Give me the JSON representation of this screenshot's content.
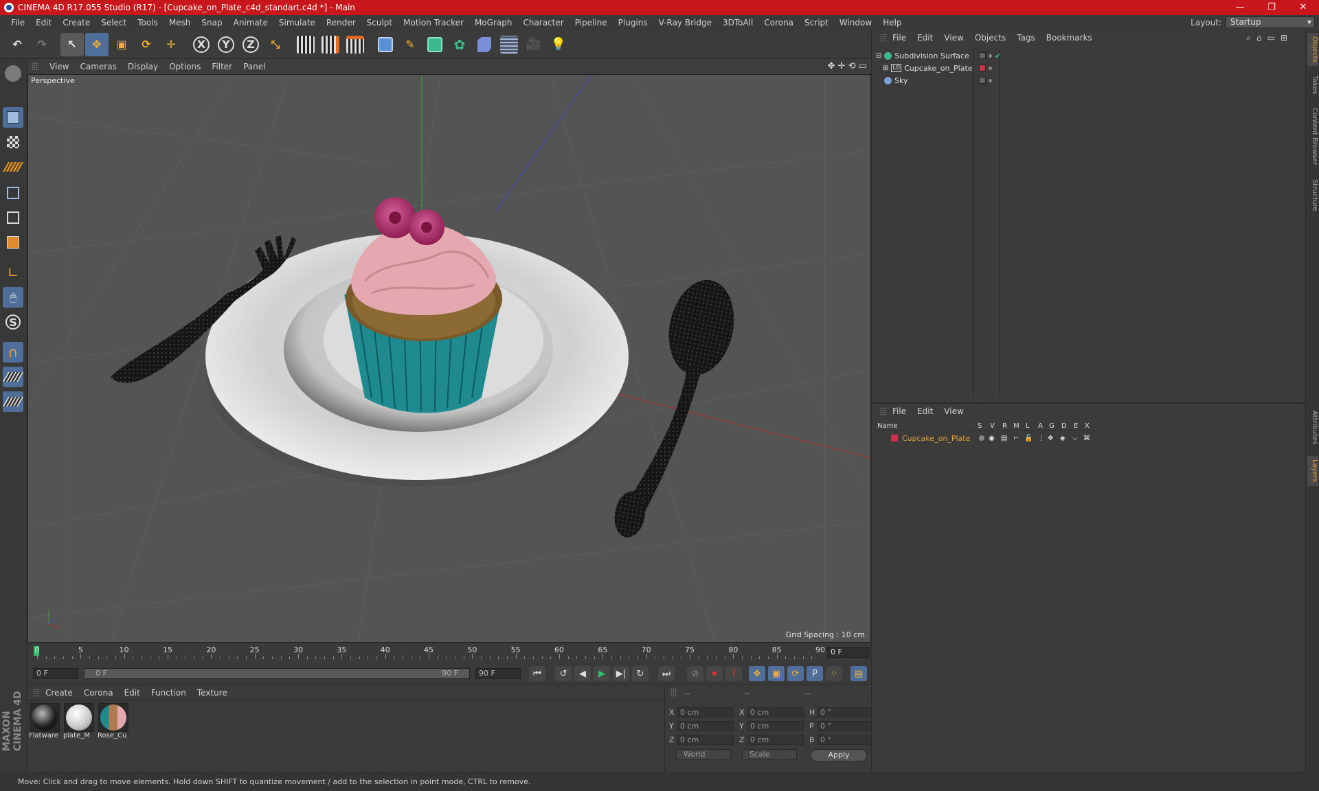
{
  "window": {
    "title": "CINEMA 4D R17.055 Studio (R17) - [Cupcake_on_Plate_c4d_standart.c4d *] - Main",
    "min": "—",
    "max": "❐",
    "close": "✕"
  },
  "menu": [
    "File",
    "Edit",
    "Create",
    "Select",
    "Tools",
    "Mesh",
    "Snap",
    "Animate",
    "Simulate",
    "Render",
    "Sculpt",
    "Motion Tracker",
    "MoGraph",
    "Character",
    "Pipeline",
    "Plugins",
    "V-Ray Bridge",
    "3DToAll",
    "Corona",
    "Script",
    "Window",
    "Help"
  ],
  "layout": {
    "label": "Layout:",
    "value": "Startup"
  },
  "toolbar": {
    "undo": "↶",
    "redo": "↷",
    "select": "↖",
    "move": "✥",
    "scale": "▣",
    "rotate": "⟳",
    "transform": "✛",
    "x": "X",
    "y": "Y",
    "z": "Z",
    "coord": "⤡"
  },
  "viewport": {
    "menu": [
      "View",
      "Cameras",
      "Display",
      "Options",
      "Filter",
      "Panel"
    ],
    "label": "Perspective",
    "grid_spacing": "Grid Spacing : 10 cm",
    "nav": "✥ ✛ ⟲ ▭"
  },
  "timeline": {
    "labels": [
      "0",
      "5",
      "10",
      "15",
      "20",
      "25",
      "30",
      "35",
      "40",
      "45",
      "50",
      "55",
      "60",
      "65",
      "70",
      "75",
      "80",
      "85",
      "90"
    ],
    "current_frame": "0 F",
    "start": "0 F",
    "range_start": "0 F",
    "range_end": "90 F",
    "end": "90 F"
  },
  "materials": {
    "menu": [
      "Create",
      "Corona",
      "Edit",
      "Function",
      "Texture"
    ],
    "items": [
      {
        "name": "Flatware"
      },
      {
        "name": "plate_M"
      },
      {
        "name": "Rose_Cu"
      }
    ]
  },
  "coords": {
    "head": [
      "--",
      "--",
      "--"
    ],
    "rows": [
      {
        "a1": "X",
        "v1": "0 cm",
        "a2": "X",
        "v2": "0 cm",
        "a3": "H",
        "v3": "0 °"
      },
      {
        "a1": "Y",
        "v1": "0 cm",
        "a2": "Y",
        "v2": "0 cm",
        "a3": "P",
        "v3": "0 °"
      },
      {
        "a1": "Z",
        "v1": "0 cm",
        "a2": "Z",
        "v2": "0 cm",
        "a3": "B",
        "v3": "0 °"
      }
    ],
    "world": "World",
    "scale": "Scale",
    "apply": "Apply"
  },
  "objects": {
    "menu": [
      "File",
      "Edit",
      "View",
      "Objects",
      "Tags",
      "Bookmarks"
    ],
    "items": [
      {
        "name": "Subdivision Surface",
        "prefix": "⊟"
      },
      {
        "name": "Cupcake_on_Plate",
        "prefix": "⊞",
        "badge": "L0"
      },
      {
        "name": "Sky",
        "prefix": ""
      }
    ]
  },
  "layers": {
    "menu": [
      "File",
      "Edit",
      "View"
    ],
    "cols": [
      "Name",
      "S",
      "V",
      "R",
      "M",
      "L",
      "A",
      "G",
      "D",
      "E",
      "X"
    ],
    "row": {
      "name": "Cupcake_on_Plate",
      "color": "#c8324a"
    }
  },
  "right_tabs": [
    "Objects",
    "Takes",
    "Content Browser",
    "Structure",
    "Attributes",
    "Layers"
  ],
  "status": "Move: Click and drag to move elements. Hold down SHIFT to quantize movement / add to the selection in point mode, CTRL to remove.",
  "brand": "MAXON CINEMA 4D",
  "colors": {
    "title_bar": "#c8161d",
    "accent": "#e0a040",
    "active_icon": "#5b8fd6"
  }
}
